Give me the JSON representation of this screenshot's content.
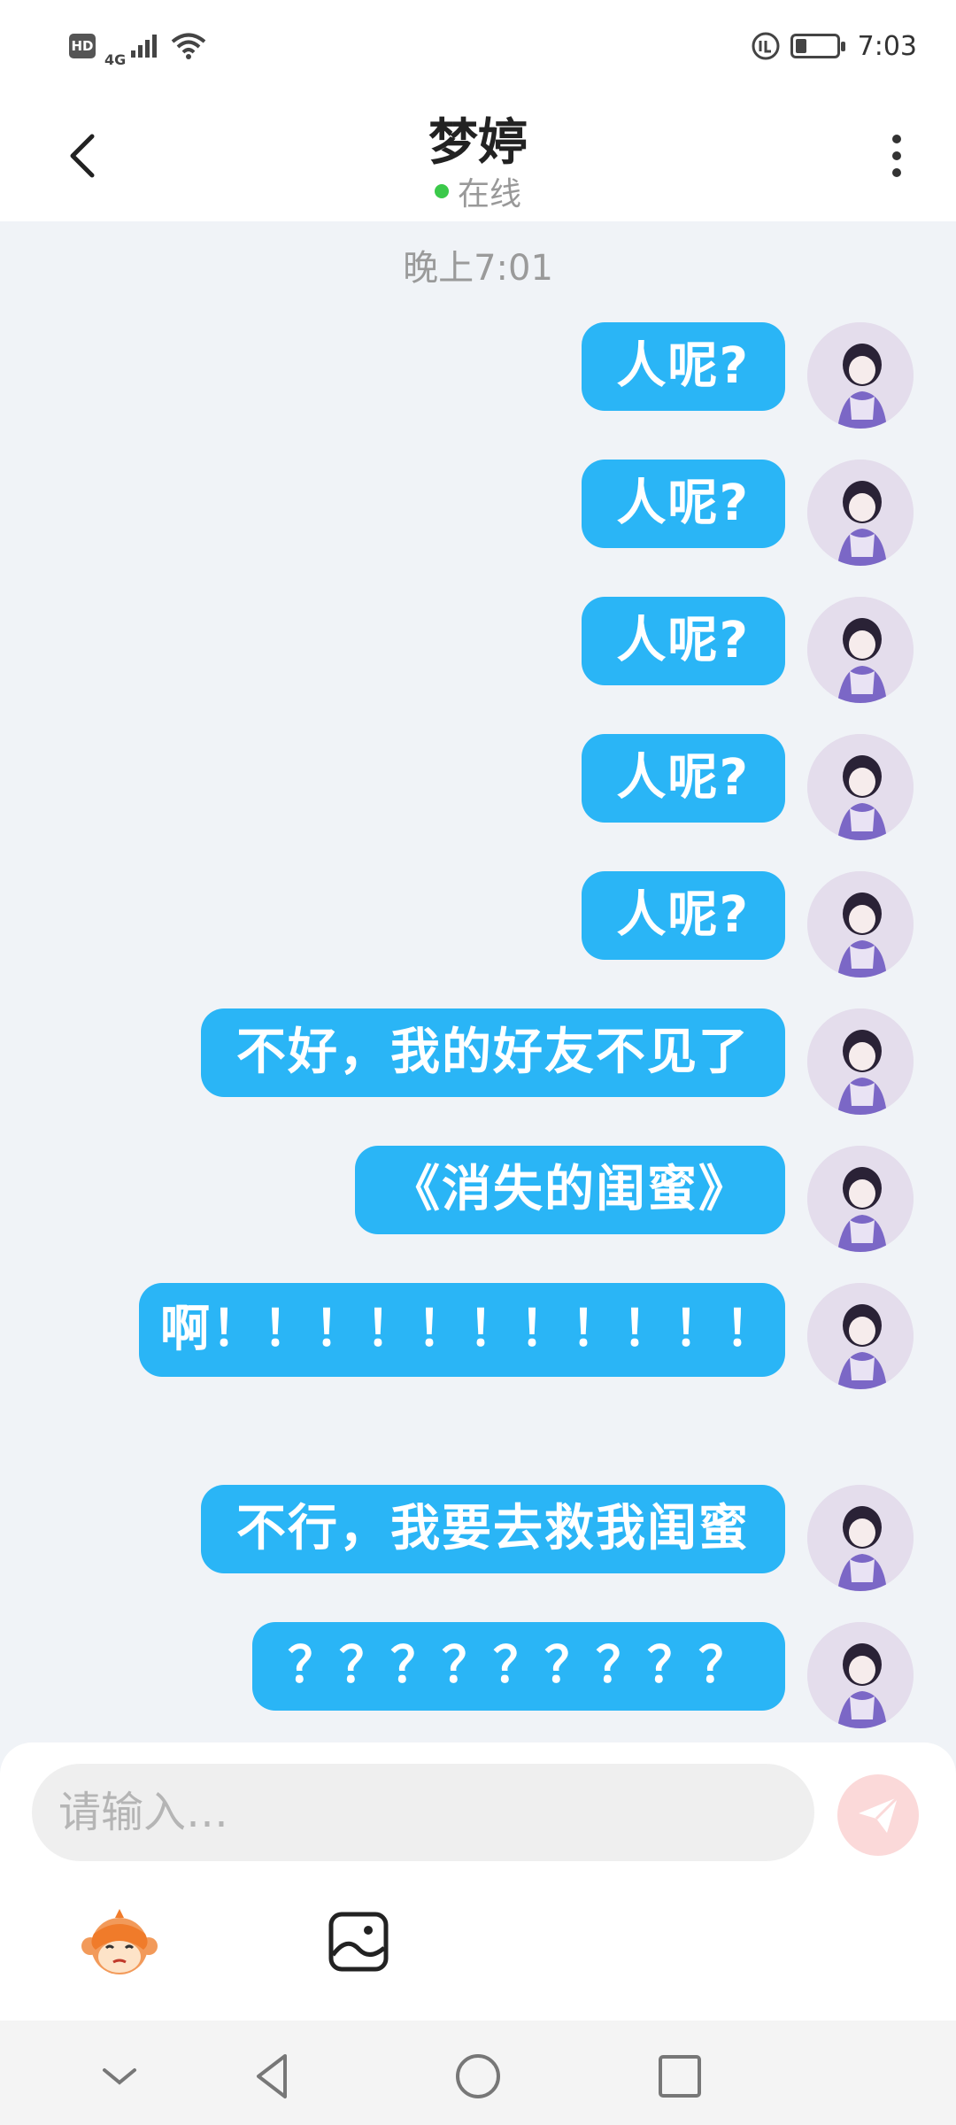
{
  "status_bar": {
    "hd": "HD",
    "network": "4G",
    "time": "7:03"
  },
  "header": {
    "name": "梦婷",
    "status": "在线"
  },
  "chat": {
    "timestamp": "晚上7:01",
    "messages": [
      {
        "text": "人呢?"
      },
      {
        "text": "人呢?"
      },
      {
        "text": "人呢?"
      },
      {
        "text": "人呢?"
      },
      {
        "text": "人呢?"
      },
      {
        "text": "不好，我的好友不见了"
      },
      {
        "text": "《消失的闺蜜》"
      },
      {
        "text": "啊！！！！！！！！！！！"
      },
      {
        "text": "不行，我要去救我闺蜜"
      },
      {
        "text": "？？？？？？？？？"
      }
    ]
  },
  "input": {
    "placeholder": "请输入…"
  },
  "colors": {
    "bubble": "#2ab5f6",
    "online": "#3bc94a",
    "send_button": "#fbd9d9"
  },
  "icons": {
    "back": "chevron-left-icon",
    "more": "more-vertical-icon",
    "send": "paper-plane-icon",
    "emoji": "monkey-emoji-icon",
    "image": "image-icon"
  }
}
